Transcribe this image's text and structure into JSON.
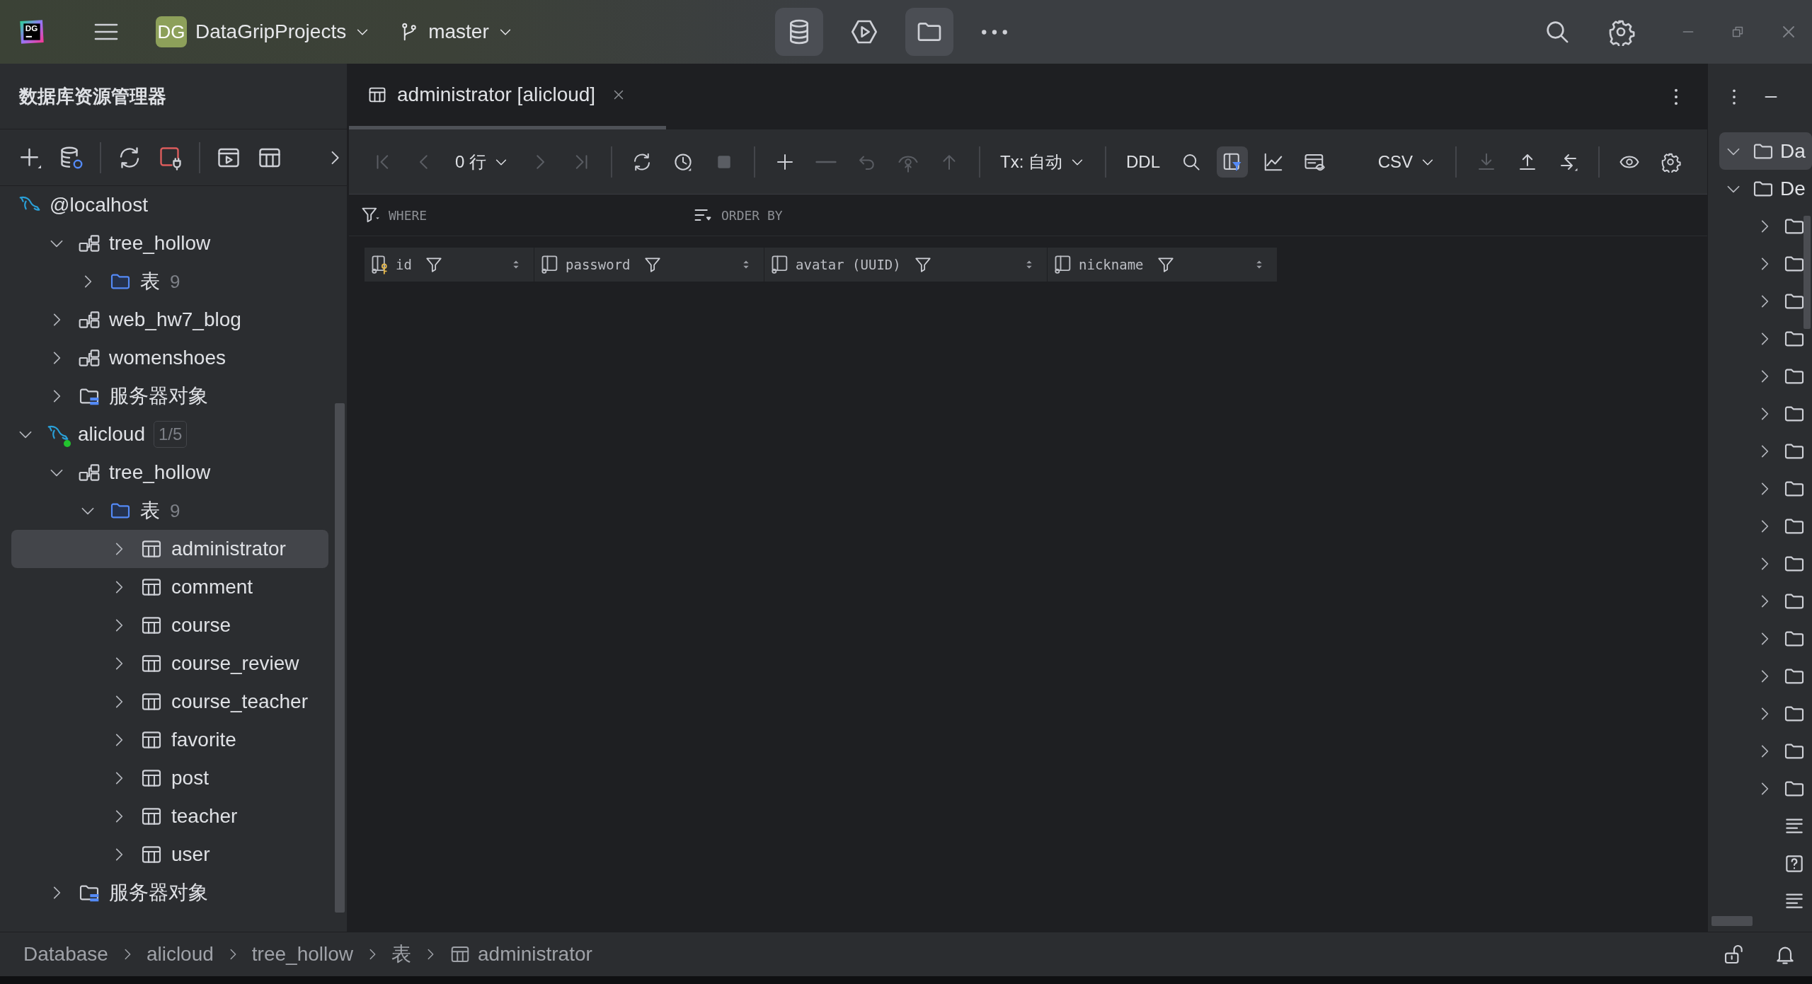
{
  "top_bar": {
    "app_logo": "DG",
    "project_badge": "DG",
    "project": "DataGripProjects",
    "branch": "master",
    "tools": [
      {
        "kind": "database",
        "selected": true
      },
      {
        "kind": "run",
        "selected": false
      },
      {
        "kind": "folder",
        "selected": true
      },
      {
        "kind": "more",
        "selected": false
      }
    ]
  },
  "explorer": {
    "title": "数据库资源管理器",
    "tree": [
      {
        "kind": "datasource",
        "label": "@localhost",
        "connected": false,
        "selected": false,
        "children": [
          {
            "kind": "schema",
            "label": "tree_hollow",
            "expanded": true,
            "selected": false,
            "children": [
              {
                "kind": "folder",
                "label": "表",
                "count": "9",
                "expanded": false,
                "selected": false
              }
            ]
          },
          {
            "kind": "schema",
            "label": "web_hw7_blog",
            "expanded": false,
            "selected": false
          },
          {
            "kind": "schema",
            "label": "womenshoes",
            "expanded": false,
            "selected": false
          },
          {
            "kind": "server-folder",
            "label": "服务器对象",
            "expanded": false,
            "selected": false
          }
        ]
      },
      {
        "kind": "datasource",
        "label": "alicloud",
        "badge": "1/5",
        "connected": true,
        "expanded": true,
        "selected": false,
        "children": [
          {
            "kind": "schema",
            "label": "tree_hollow",
            "expanded": true,
            "selected": false,
            "children": [
              {
                "kind": "folder",
                "label": "表",
                "count": "9",
                "expanded": true,
                "selected": false,
                "children": [
                  {
                    "kind": "table",
                    "label": "administrator",
                    "expanded": false,
                    "selected": true
                  },
                  {
                    "kind": "table",
                    "label": "comment",
                    "expanded": false,
                    "selected": false
                  },
                  {
                    "kind": "table",
                    "label": "course",
                    "expanded": false,
                    "selected": false
                  },
                  {
                    "kind": "table",
                    "label": "course_review",
                    "expanded": false,
                    "selected": false
                  },
                  {
                    "kind": "table",
                    "label": "course_teacher",
                    "expanded": false,
                    "selected": false
                  },
                  {
                    "kind": "table",
                    "label": "favorite",
                    "expanded": false,
                    "selected": false
                  },
                  {
                    "kind": "table",
                    "label": "post",
                    "expanded": false,
                    "selected": false
                  },
                  {
                    "kind": "table",
                    "label": "teacher",
                    "expanded": false,
                    "selected": false
                  },
                  {
                    "kind": "table",
                    "label": "user",
                    "expanded": false,
                    "selected": false
                  }
                ]
              }
            ]
          },
          {
            "kind": "server-folder",
            "label": "服务器对象",
            "expanded": false,
            "selected": false
          }
        ]
      }
    ]
  },
  "editor": {
    "tabs": [
      {
        "title": "administrator [alicloud]",
        "selected": true
      }
    ],
    "toolbar": [
      {
        "kind": "first",
        "disabled": true
      },
      {
        "kind": "prev",
        "disabled": true
      },
      {
        "kind": "rows",
        "label": "0 行"
      },
      {
        "kind": "next",
        "disabled": true
      },
      {
        "kind": "last",
        "disabled": true
      },
      {
        "kind": "separator"
      },
      {
        "kind": "reload",
        "disabled": false
      },
      {
        "kind": "history",
        "disabled": false
      },
      {
        "kind": "stop",
        "disabled": true
      },
      {
        "kind": "separator"
      },
      {
        "kind": "add",
        "disabled": false
      },
      {
        "kind": "remove",
        "disabled": true
      },
      {
        "kind": "revert",
        "disabled": true
      },
      {
        "kind": "preview",
        "disabled": true
      },
      {
        "kind": "submit",
        "disabled": true
      },
      {
        "kind": "separator"
      },
      {
        "kind": "tx",
        "label": "Tx: 自动"
      },
      {
        "kind": "separator"
      },
      {
        "kind": "ddl",
        "label": "DDL"
      },
      {
        "kind": "search",
        "disabled": false
      },
      {
        "kind": "filter-toggle",
        "selected": true
      },
      {
        "kind": "chart",
        "disabled": false
      },
      {
        "kind": "view",
        "disabled": false
      },
      {
        "kind": "spacer"
      },
      {
        "kind": "format",
        "label": "CSV"
      },
      {
        "kind": "separator"
      },
      {
        "kind": "import",
        "disabled": true
      },
      {
        "kind": "export",
        "disabled": false
      },
      {
        "kind": "compare",
        "disabled": false
      },
      {
        "kind": "separator"
      },
      {
        "kind": "eye",
        "disabled": false
      },
      {
        "kind": "settings",
        "disabled": false
      }
    ],
    "filter": {
      "where": {
        "placeholder": "WHERE"
      },
      "order_by": {
        "placeholder": "ORDER BY"
      }
    },
    "columns": [
      {
        "name": "id",
        "kind": "key"
      },
      {
        "name": "password",
        "kind": "column"
      },
      {
        "name": "avatar (UUID)",
        "kind": "column"
      },
      {
        "name": "nickname",
        "kind": "column"
      }
    ]
  },
  "right_panel": {
    "tree": [
      {
        "kind": "folder-plain",
        "label": "Da",
        "expanded": true,
        "selected": true
      },
      {
        "kind": "folder-plain",
        "label": "De",
        "expanded": true,
        "selected": false,
        "children": [
          {
            "kind": "folder-plain",
            "expanded": false,
            "selected": false
          },
          {
            "kind": "folder-plain",
            "expanded": false,
            "selected": false
          },
          {
            "kind": "folder-plain",
            "expanded": false,
            "selected": false
          },
          {
            "kind": "folder-plain",
            "expanded": false,
            "selected": false
          },
          {
            "kind": "folder-plain",
            "expanded": false,
            "selected": false
          },
          {
            "kind": "folder-plain",
            "expanded": false,
            "selected": false
          },
          {
            "kind": "folder-plain",
            "expanded": false,
            "selected": false
          },
          {
            "kind": "folder-plain",
            "expanded": false,
            "selected": false
          },
          {
            "kind": "folder-plain",
            "expanded": false,
            "selected": false
          },
          {
            "kind": "folder-plain",
            "expanded": false,
            "selected": false
          },
          {
            "kind": "folder-plain",
            "expanded": false,
            "selected": false
          },
          {
            "kind": "folder-plain",
            "expanded": false,
            "selected": false
          },
          {
            "kind": "folder-plain",
            "expanded": false,
            "selected": false
          },
          {
            "kind": "folder-plain",
            "expanded": false,
            "selected": false
          },
          {
            "kind": "folder-plain",
            "expanded": false,
            "selected": false
          },
          {
            "kind": "folder-plain",
            "expanded": false,
            "selected": false
          },
          {
            "kind": "lines",
            "selected": false
          },
          {
            "kind": "help",
            "selected": false
          },
          {
            "kind": "lines",
            "selected": false
          }
        ]
      }
    ]
  },
  "status_bar": {
    "breadcrumbs": [
      {
        "kind": "text",
        "label": "Database"
      },
      {
        "kind": "text",
        "label": "alicloud"
      },
      {
        "kind": "text",
        "label": "tree_hollow"
      },
      {
        "kind": "text",
        "label": "表"
      },
      {
        "kind": "table",
        "label": "administrator"
      }
    ]
  }
}
